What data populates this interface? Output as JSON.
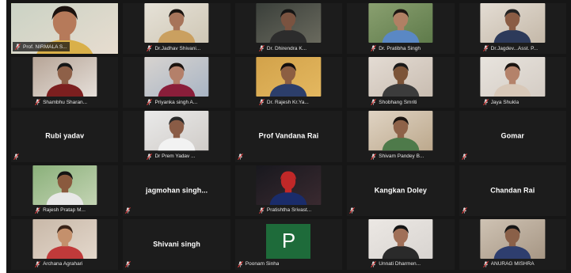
{
  "participants": [
    {
      "label": "Prof. NIRMALA S...",
      "video": true,
      "active": true,
      "bg": [
        "#c9d2c4",
        "#e9ddd0"
      ],
      "skin": "#b67a5a",
      "shirt": "#d9b04a",
      "hair": "#1b120e"
    },
    {
      "label": "Dr.Jadhav Shivani...",
      "video": true,
      "bg": [
        "#e6e2d8",
        "#cfc7b5"
      ],
      "skin": "#a7745a",
      "shirt": "#caa060",
      "hair": "#1a1410"
    },
    {
      "label": "Dr. Dhirendra K...",
      "video": true,
      "bg": [
        "#3a3f3a",
        "#6a6a5e"
      ],
      "skin": "#7a5340",
      "shirt": "#2c2c2c",
      "hair": "#141414"
    },
    {
      "label": "Dr. Pratibha Singh",
      "video": true,
      "bg": [
        "#8aa070",
        "#5e7a4a"
      ],
      "skin": "#b08064",
      "shirt": "#5a88c4",
      "hair": "#1c1612"
    },
    {
      "label": "Dr.Jagdev...Asst. P...",
      "video": true,
      "bg": [
        "#e4ddd4",
        "#c4b8a8"
      ],
      "skin": "#8a5c44",
      "shirt": "#2d3a5a",
      "hair": "#222"
    },
    {
      "label": "Shambhu Sharan...",
      "video": true,
      "bg": [
        "#b6a496",
        "#e6e0da"
      ],
      "skin": "#8e6048",
      "shirt": "#7c1f1f",
      "hair": "#161616"
    },
    {
      "label": "Priyanka singh A...",
      "video": true,
      "bg": [
        "#d8d4d0",
        "#a8b4c4"
      ],
      "skin": "#b4806a",
      "shirt": "#8a1e3a",
      "hair": "#1c1410"
    },
    {
      "label": "Dr. Rajesh Kr.Ya...",
      "video": true,
      "bg": [
        "#d2a24a",
        "#e4b860"
      ],
      "skin": "#8c5e42",
      "shirt": "#2c3e6a",
      "hair": "#141010"
    },
    {
      "label": "Shobhang Smriti",
      "video": true,
      "bg": [
        "#e4dcd4",
        "#c8bcb0"
      ],
      "skin": "#7c5438",
      "shirt": "#3c3c3c",
      "hair": "#1a1a1a"
    },
    {
      "label": "Jaya Shukla",
      "video": true,
      "bg": [
        "#e8e4de",
        "#d4ccc4"
      ],
      "skin": "#b4826a",
      "shirt": "#d8c8b8",
      "hair": "#1a1410"
    },
    {
      "label": "",
      "center": "Rubi yadav",
      "video": false
    },
    {
      "label": "Dr Prem Yadav ...",
      "video": true,
      "bg": [
        "#eaeaea",
        "#d0ccc8"
      ],
      "skin": "#8a5c46",
      "shirt": "#f2f2f2",
      "hair": "#2a2a2a"
    },
    {
      "label": "",
      "center": "Prof Vandana Rai",
      "video": false
    },
    {
      "label": "Shivam Pandey B...",
      "video": true,
      "bg": [
        "#e0d4c4",
        "#bca88c"
      ],
      "skin": "#8e6248",
      "shirt": "#4e7a4a",
      "hair": "#1a1410"
    },
    {
      "label": "",
      "center": "Gomar",
      "video": false
    },
    {
      "label": "Rajesh Pratap M...",
      "video": true,
      "bg": [
        "#8ab07a",
        "#c4d4b4"
      ],
      "skin": "#8a5a3e",
      "shirt": "#e8e8e8",
      "hair": "#141414"
    },
    {
      "label": "",
      "center": "jagmohan singh...",
      "video": false
    },
    {
      "label": "Pratishtha Srivast...",
      "video": true,
      "bg": [
        "#18181e",
        "#3a2a30"
      ],
      "skin": "#c02828",
      "shirt": "#1a2c6a",
      "hair": "#c02828"
    },
    {
      "label": "",
      "center": "Kangkan Doley",
      "video": false
    },
    {
      "label": "",
      "center": "Chandan Rai",
      "video": false
    },
    {
      "label": "Archana Agrahari",
      "video": true,
      "bg": [
        "#c8b8a8",
        "#e4d8cc"
      ],
      "skin": "#c4906c",
      "shirt": "#c03a3a",
      "hair": "#3a2418"
    },
    {
      "label": "",
      "center": "Shivani singh",
      "video": false
    },
    {
      "label": "Poonam Sinha",
      "avatar": "P",
      "video": false
    },
    {
      "label": "Unnati Dharmen...",
      "video": true,
      "bg": [
        "#ece8e4",
        "#d8d4d0"
      ],
      "skin": "#a07058",
      "shirt": "#2a2a2a",
      "hair": "#141414"
    },
    {
      "label": "ANURAG MISHRA",
      "video": true,
      "bg": [
        "#cfc3b4",
        "#a69684"
      ],
      "skin": "#8a6048",
      "shirt": "#2e3e6e",
      "hair": "#161616"
    }
  ]
}
